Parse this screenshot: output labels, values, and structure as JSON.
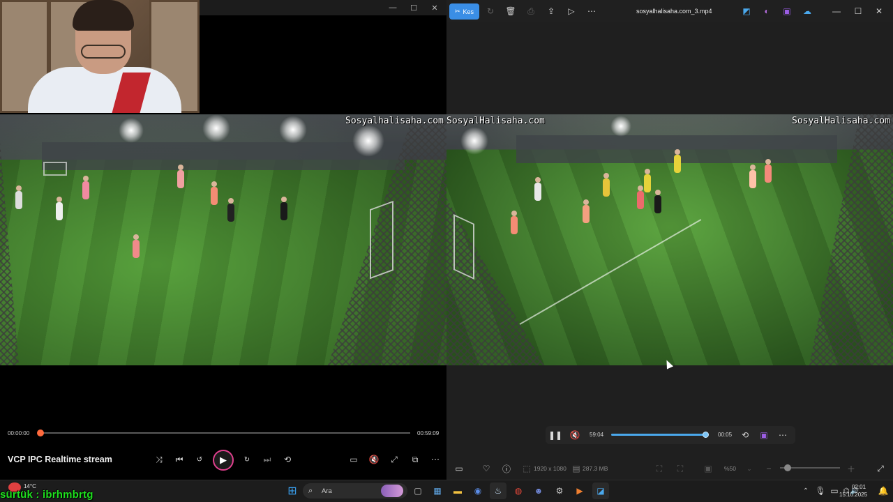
{
  "left_player": {
    "time_current": "00:00:00",
    "time_total": "00:59:09",
    "title": "VCP IPC Realtime stream",
    "progress_fraction": 0.0,
    "watermark": "Sosyalhalisaha.com"
  },
  "right_app": {
    "edit_button": "Kes",
    "filename": "sosyalhalisaha.com_3.mp4",
    "watermark_left": "SosyalHalisaha.com",
    "watermark_right": "SosyalHalisaha.com",
    "time_elapsed": "59:04",
    "time_remaining": "00:05",
    "progress_fraction": 0.99,
    "resolution": "1920 x 1080",
    "file_size": "287.3 MB",
    "zoom_level": "%50"
  },
  "taskbar": {
    "weather_temp": "14°C",
    "search_label": "Ara",
    "clock_time": "02:01",
    "clock_date": "15.10.2025"
  },
  "overlay": {
    "chat_text": "sürtük : ibrhmbrtg"
  },
  "colors": {
    "accent_blue": "#3a8ee6",
    "progress_orange": "#ff6a3d",
    "play_ring": "#e0408e",
    "chat_green": "#1fe01f"
  }
}
